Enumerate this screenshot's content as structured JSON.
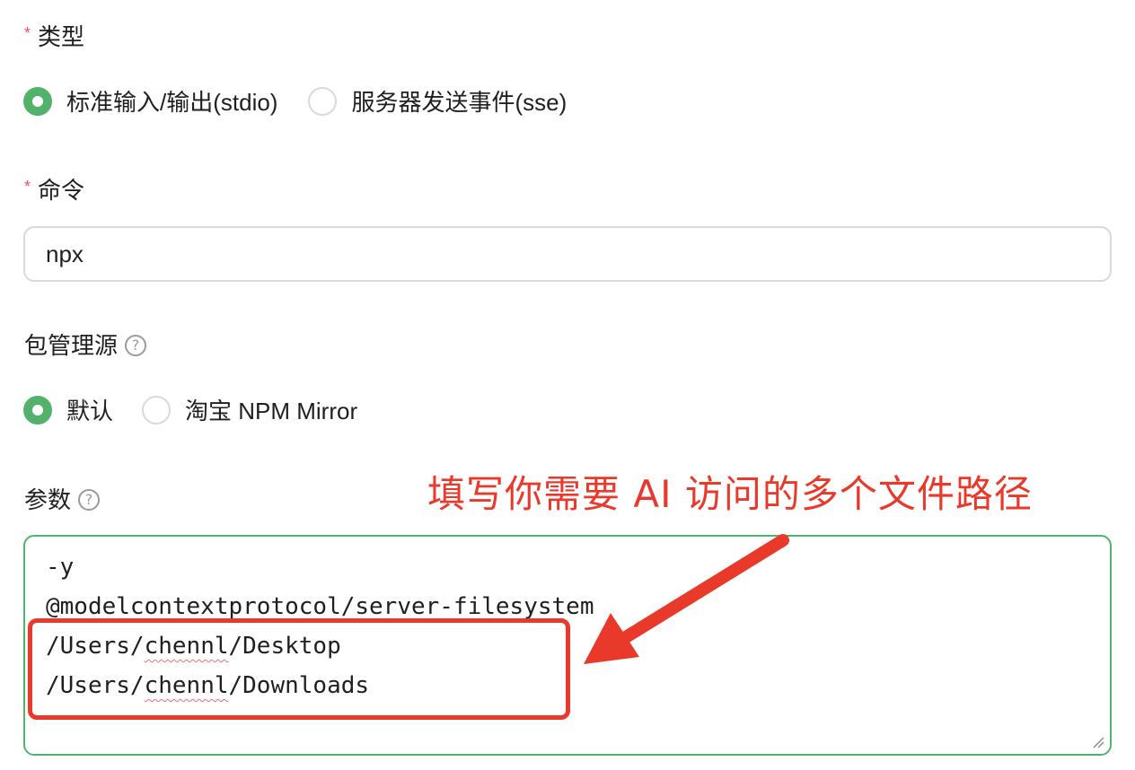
{
  "type_field": {
    "required_mark": "*",
    "label": "类型",
    "options": [
      {
        "label": "标准输入/输出(stdio)",
        "checked": true
      },
      {
        "label": "服务器发送事件(sse)",
        "checked": false
      }
    ]
  },
  "command_field": {
    "required_mark": "*",
    "label": "命令",
    "value": "npx"
  },
  "registry_field": {
    "label": "包管理源",
    "help_icon": "help-circle-icon",
    "help_glyph": "?",
    "options": [
      {
        "label": "默认",
        "checked": true
      },
      {
        "label": "淘宝 NPM Mirror",
        "checked": false
      }
    ]
  },
  "args_field": {
    "label": "参数",
    "help_icon": "help-circle-icon",
    "help_glyph": "?",
    "lines": [
      "-y",
      "@modelcontextprotocol/server-filesystem",
      "/Users/chennl/Desktop",
      "/Users/chennl/Downloads"
    ],
    "underlined_word": "chennl"
  },
  "annotation": {
    "text": "填写你需要 AI 访问的多个文件路径",
    "color": "#e8392b"
  },
  "colors": {
    "accent": "#52b26b",
    "required": "#ff4d4f",
    "annotation": "#e8392b"
  }
}
